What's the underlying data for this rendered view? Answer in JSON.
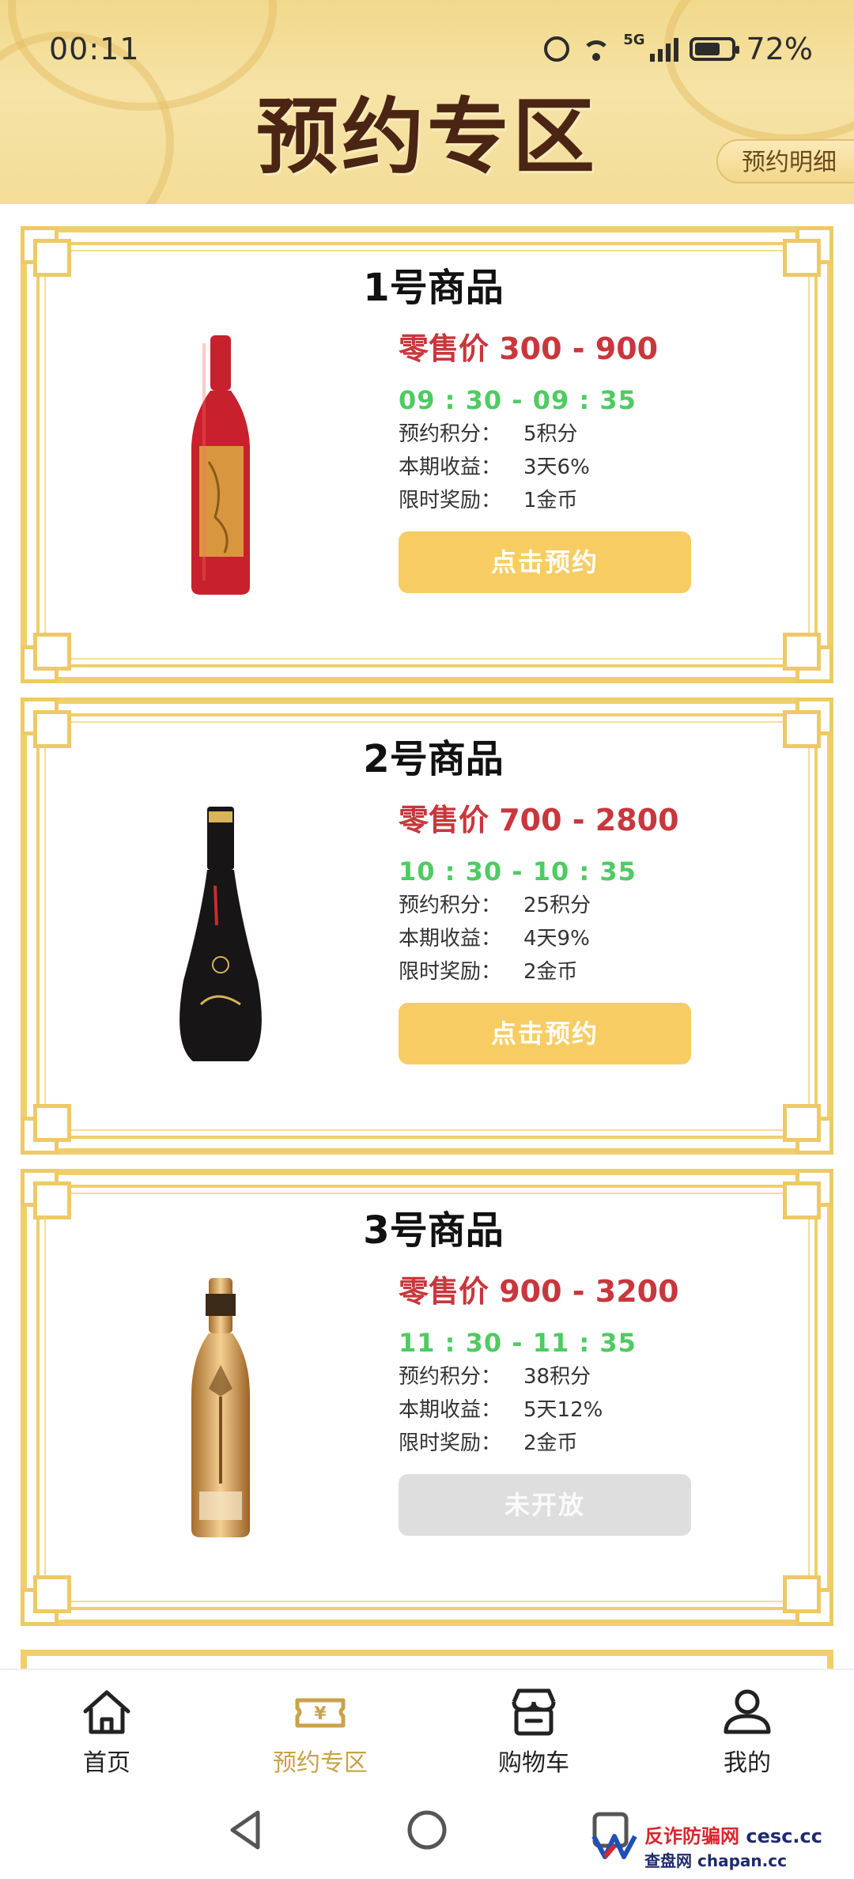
{
  "status_bar": {
    "time": "00:11",
    "network": "5G",
    "battery": "72%"
  },
  "header": {
    "title": "预约专区",
    "detail_button": "预约明细"
  },
  "products": [
    {
      "name": "1号商品",
      "price": "零售价 300 - 900",
      "time": "09 : 30 - 09 : 35",
      "points_label": "预约积分：",
      "points_value": "5积分",
      "earnings_label": "本期收益：",
      "earnings_value": "3天6%",
      "reward_label": "限时奖励：",
      "reward_value": "1金币",
      "button": "点击预约",
      "bottle_color": "#c8202c"
    },
    {
      "name": "2号商品",
      "price": "零售价 700 - 2800",
      "time": "10 : 30 - 10 : 35",
      "points_label": "预约积分：",
      "points_value": "25积分",
      "earnings_label": "本期收益：",
      "earnings_value": "4天9%",
      "reward_label": "限时奖励：",
      "reward_value": "2金币",
      "button": "点击预约",
      "bottle_color": "#181516"
    },
    {
      "name": "3号商品",
      "price": "零售价 900 - 3200",
      "time": "11 : 30 - 11 : 35",
      "points_label": "预约积分：",
      "points_value": "38积分",
      "earnings_label": "本期收益：",
      "earnings_value": "5天12%",
      "reward_label": "限时奖励：",
      "reward_value": "2金币",
      "button": "未开放",
      "bottle_color": "#d7a260"
    }
  ],
  "bottom_nav": [
    {
      "label": "首页",
      "icon": "home-icon"
    },
    {
      "label": "预约专区",
      "icon": "ticket-icon",
      "active": true
    },
    {
      "label": "购物车",
      "icon": "store-cart-icon"
    },
    {
      "label": "我的",
      "icon": "user-icon"
    }
  ],
  "watermark": {
    "line1": "反诈防骗网",
    "line1_domain": "cesc.cc",
    "line2": "查盘网",
    "line2_domain": "chapan.cc"
  },
  "colors": {
    "accent_gold": "#f0cf6b",
    "button_gold": "#f7cd63",
    "price_red": "#c8373d",
    "time_green": "#4ecb62",
    "active_nav": "#c9a24a"
  }
}
